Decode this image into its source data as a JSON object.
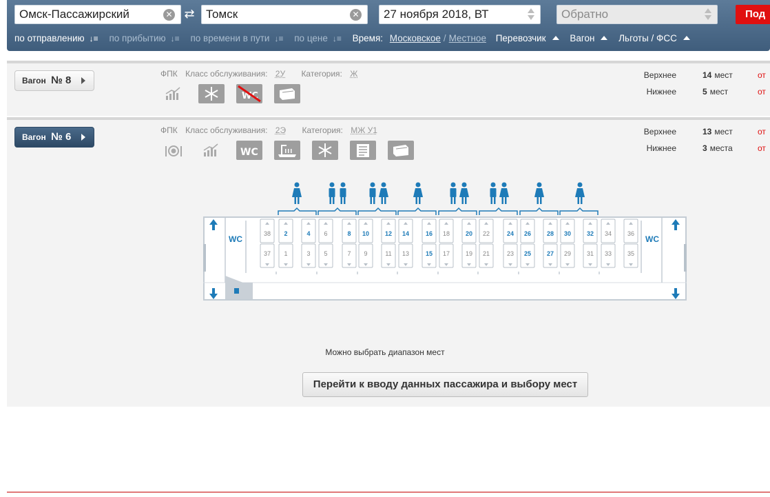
{
  "search": {
    "from": "Омск-Пассажирский",
    "to": "Томск",
    "date": "27 ноября 2018, ВТ",
    "back_placeholder": "Обратно",
    "submit": "Под"
  },
  "sort": {
    "by_departure": "по отправлению",
    "by_arrival": "по прибытию",
    "by_travel_time": "по времени в пути",
    "by_price": "по цене",
    "time_label": "Время:",
    "time_moscow": "Московское",
    "time_separator": "/",
    "time_local": "Местное",
    "carrier": "Перевозчик",
    "wagon": "Вагон",
    "benefits": "Льготы / ФСС"
  },
  "wagons": [
    {
      "button_label": "Вагон",
      "number": "№ 8",
      "carrier": "ФПК",
      "class_label": "Класс обслуживания:",
      "class_value": "2У",
      "category_label": "Категория:",
      "category_value": "Ж",
      "icons": [
        "chart-icon",
        "snowflake-icon",
        "wc-unavailable-icon",
        "linen-icon"
      ],
      "upper_label": "Верхнее",
      "upper_count": "14",
      "upper_unit": "мест",
      "lower_label": "Нижнее",
      "lower_count": "5",
      "lower_unit": "мест",
      "price_prefix": "от"
    },
    {
      "button_label": "Вагон",
      "number": "№ 6",
      "carrier": "ФПК",
      "class_label": "Класс обслуживания:",
      "class_value": "2Э",
      "category_label": "Категория:",
      "category_value": "МЖ У1",
      "icons": [
        "dining-icon",
        "chart-icon",
        "wc-icon",
        "sink-icon",
        "snowflake-icon",
        "newspaper-icon",
        "linen-icon"
      ],
      "upper_label": "Верхнее",
      "upper_count": "13",
      "upper_unit": "мест",
      "lower_label": "Нижнее",
      "lower_count": "3",
      "lower_unit": "места",
      "price_prefix": "от"
    }
  ],
  "scheme": {
    "wc_label": "WC",
    "compartment_genders": [
      "F",
      "MM",
      "MF",
      "F",
      "MF",
      "MF",
      "F",
      "F"
    ],
    "upper_seats": [
      {
        "n": "38",
        "free": false
      },
      {
        "n": "2",
        "free": true
      },
      {
        "n": "4",
        "free": true
      },
      {
        "n": "6",
        "free": false
      },
      {
        "n": "8",
        "free": true
      },
      {
        "n": "10",
        "free": true
      },
      {
        "n": "12",
        "free": true
      },
      {
        "n": "14",
        "free": true
      },
      {
        "n": "16",
        "free": true
      },
      {
        "n": "18",
        "free": false
      },
      {
        "n": "20",
        "free": true
      },
      {
        "n": "22",
        "free": false
      },
      {
        "n": "24",
        "free": true
      },
      {
        "n": "26",
        "free": true
      },
      {
        "n": "28",
        "free": true
      },
      {
        "n": "30",
        "free": true
      },
      {
        "n": "32",
        "free": true
      },
      {
        "n": "34",
        "free": false
      },
      {
        "n": "36",
        "free": false
      }
    ],
    "lower_seats": [
      {
        "n": "37",
        "free": false
      },
      {
        "n": "1",
        "free": false
      },
      {
        "n": "3",
        "free": false
      },
      {
        "n": "5",
        "free": false
      },
      {
        "n": "7",
        "free": false
      },
      {
        "n": "9",
        "free": false
      },
      {
        "n": "11",
        "free": false
      },
      {
        "n": "13",
        "free": false
      },
      {
        "n": "15",
        "free": true
      },
      {
        "n": "17",
        "free": false
      },
      {
        "n": "19",
        "free": false
      },
      {
        "n": "21",
        "free": false
      },
      {
        "n": "23",
        "free": false
      },
      {
        "n": "25",
        "free": true
      },
      {
        "n": "27",
        "free": true
      },
      {
        "n": "29",
        "free": false
      },
      {
        "n": "31",
        "free": false
      },
      {
        "n": "33",
        "free": false
      },
      {
        "n": "35",
        "free": false
      }
    ]
  },
  "hint": "Можно выбрать диапазон мест",
  "continue_button": "Перейти к вводу данных пассажира и выбору мест",
  "colors": {
    "accent_blue": "#1e7bb8",
    "header_blue": "#4b6987",
    "submit_red": "#e01010",
    "icon_gray": "#9e9e9e"
  }
}
